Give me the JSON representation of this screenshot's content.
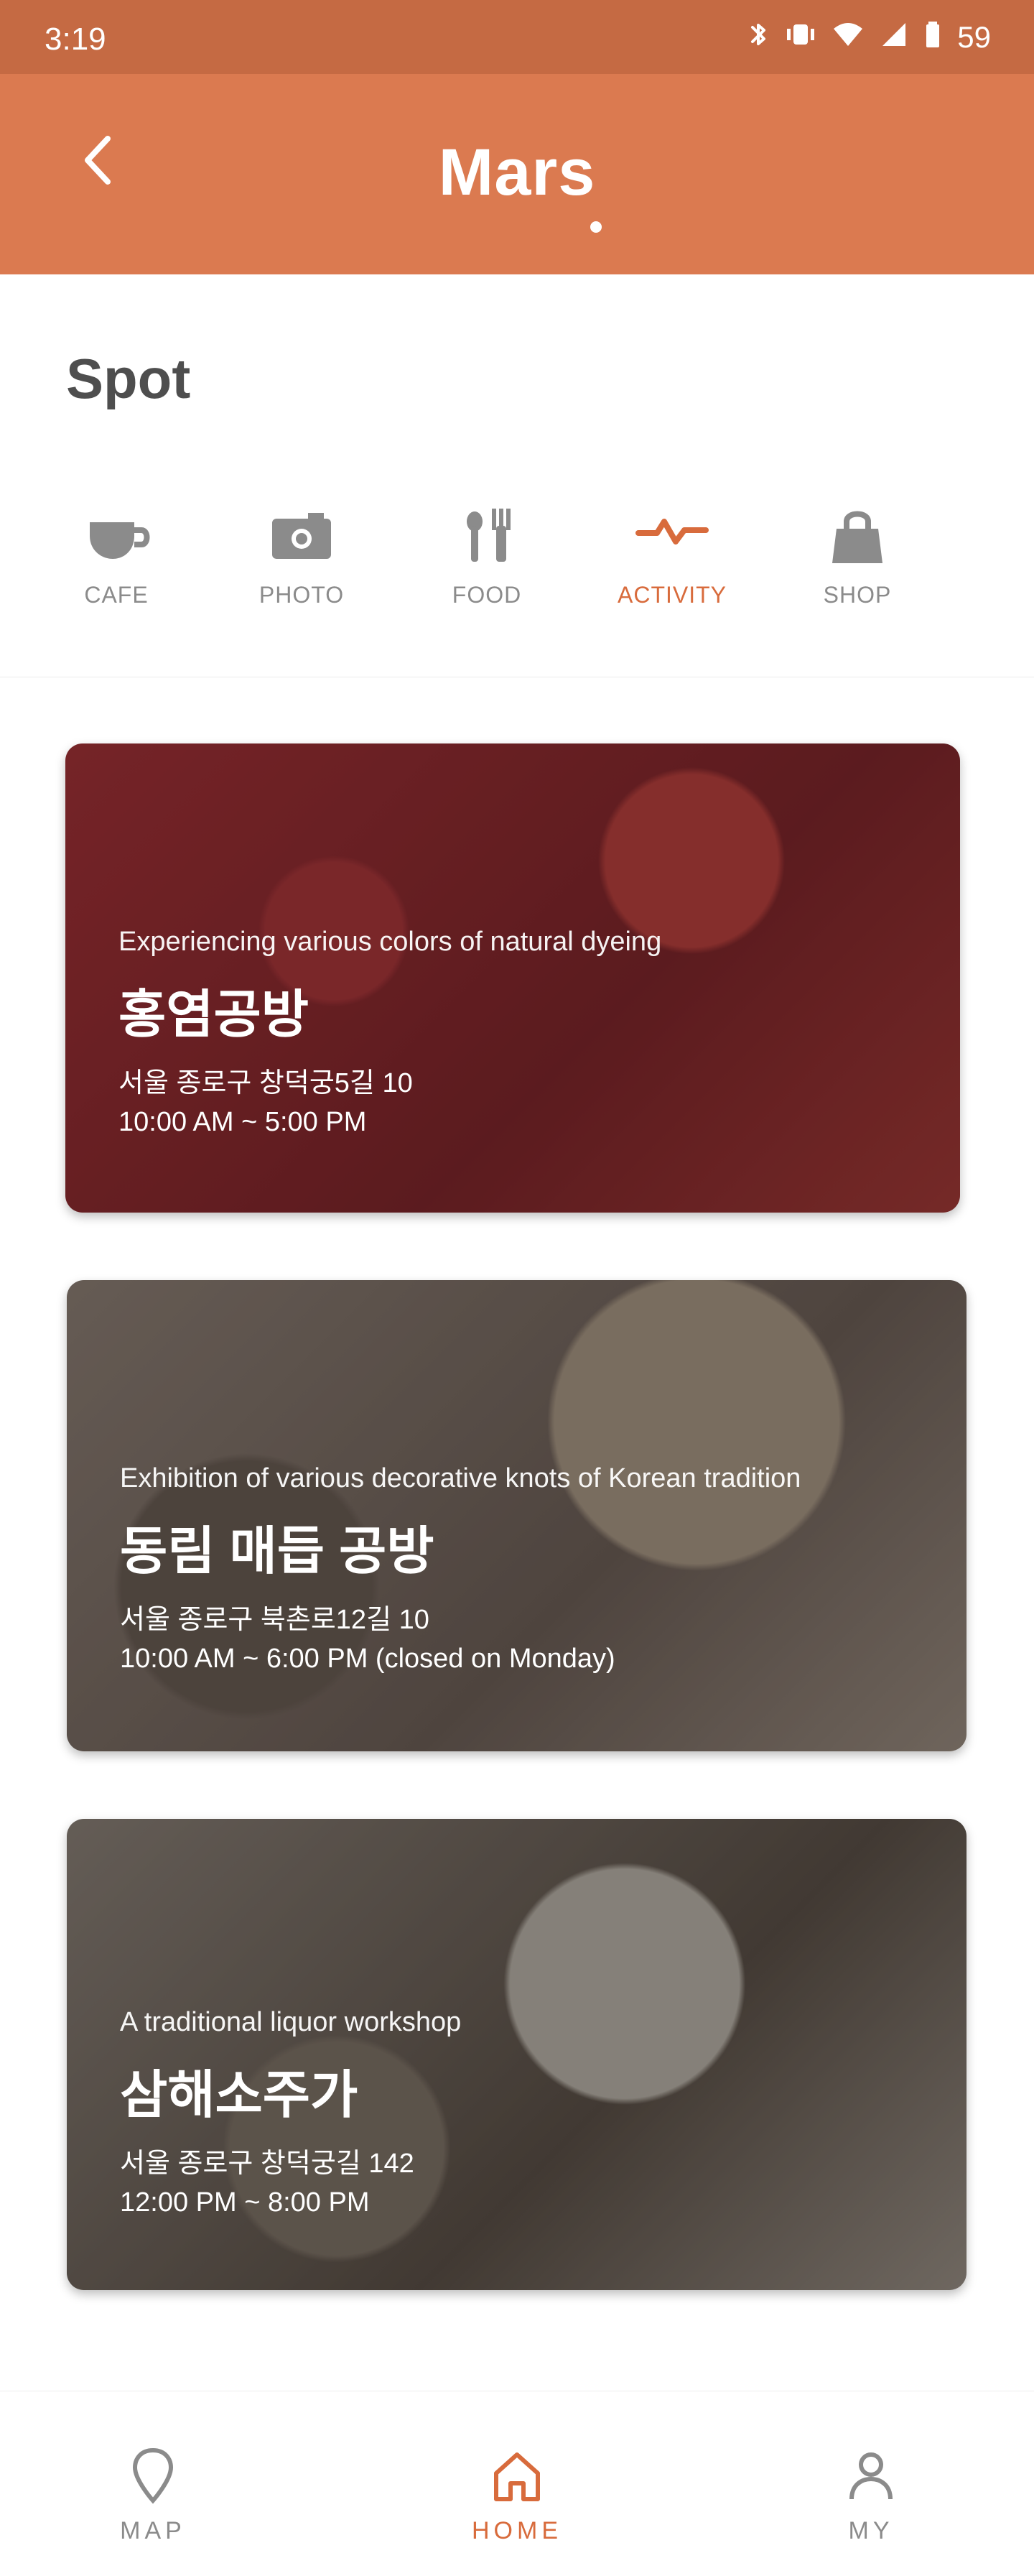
{
  "status_bar": {
    "time": "3:19",
    "battery": "59"
  },
  "app_bar": {
    "title": "Mars"
  },
  "spot": {
    "section_title": "Spot",
    "tabs": [
      {
        "label": "CAFE",
        "icon": "cafe-icon"
      },
      {
        "label": "PHOTO",
        "icon": "camera-icon"
      },
      {
        "label": "FOOD",
        "icon": "food-icon"
      },
      {
        "label": "ACTIVITY",
        "icon": "activity-icon",
        "active": true
      },
      {
        "label": "SHOP",
        "icon": "shop-icon"
      }
    ]
  },
  "cards": [
    {
      "subtitle": "Experiencing various colors of natural dyeing",
      "title": "홍염공방",
      "address": "서울 종로구 창덕궁5길 10",
      "hours": "10:00 AM ~ 5:00 PM"
    },
    {
      "subtitle": "Exhibition of various decorative knots of Korean tradition",
      "title": "동림 매듭 공방",
      "address": "서울 종로구 북촌로12길 10",
      "hours": "10:00 AM ~ 6:00 PM  (closed on Monday)"
    },
    {
      "subtitle": "A traditional liquor workshop",
      "title": "삼해소주가",
      "address": "서울 종로구 창덕궁길 142",
      "hours": "12:00 PM ~ 8:00 PM"
    }
  ],
  "bottom_nav": [
    {
      "label": "MAP",
      "icon": "map-pin-icon"
    },
    {
      "label": "HOME",
      "icon": "home-icon",
      "active": true
    },
    {
      "label": "MY",
      "icon": "user-icon"
    }
  ],
  "colors": {
    "accent": "#db7a50",
    "accent_deep": "#d86b3c"
  }
}
